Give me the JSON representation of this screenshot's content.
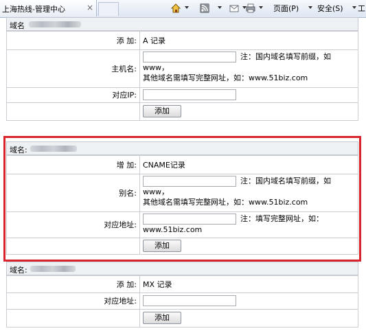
{
  "browser": {
    "tab_title": "上海热线-管理中心",
    "tab_close": "×",
    "menu_page": "页面(P)",
    "menu_safety": "安全(S)",
    "menu_tools_partial": "工"
  },
  "sections": [
    {
      "header_label": "域名",
      "rows": {
        "add_label": "添 加:",
        "add_value": "A 记录",
        "host_label": "主机名:",
        "host_note_1": "注：国内域名填写前缀，如",
        "host_note_2": "www，",
        "host_note_3": "其他域名需填写完整网址，如：www.51biz.com",
        "ip_label": "对应IP:",
        "submit": "添加"
      }
    },
    {
      "header_label": "域名:",
      "rows": {
        "add_label": "增 加:",
        "add_value": "CNAME记录",
        "alias_label": "别名:",
        "alias_note_1": "注：国内域名填写前缀，如",
        "alias_note_2": "www，",
        "alias_note_3": "其他域名需填写完整网址，如：www.51biz.com",
        "target_label": "对应地址:",
        "target_note_1": "注：填写完整网址，如：",
        "target_note_2": "www.51biz.com",
        "submit": "添加"
      }
    },
    {
      "header_label": "域名:",
      "rows": {
        "add_label": "添 加:",
        "add_value": "MX 记录",
        "target_label": "对应地址:",
        "submit": "添加"
      }
    }
  ],
  "highlight_color": "#d9232d"
}
